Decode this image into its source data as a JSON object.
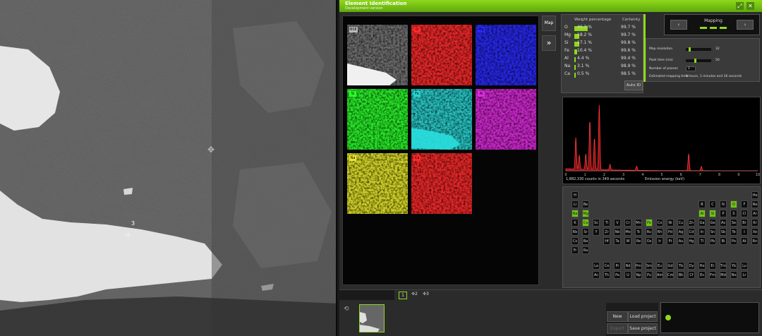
{
  "sem": {
    "point_label": "3"
  },
  "window": {
    "title": "Element Identification",
    "subtitle": "Development version",
    "pin_icon": "pin-icon",
    "close_icon": "close-icon"
  },
  "maps": [
    {
      "label": "BSE",
      "color": "#bbbbbb"
    },
    {
      "label": "O",
      "color": "#ff2a2a"
    },
    {
      "label": "Mg",
      "color": "#2a2aff"
    },
    {
      "label": "Si",
      "color": "#2aff2a"
    },
    {
      "label": "Fe",
      "color": "#2ad4d4"
    },
    {
      "label": "Al",
      "color": "#e02ae0"
    },
    {
      "label": "Na",
      "color": "#e6e62a"
    },
    {
      "label": "Ca",
      "color": "#ff2a2a"
    }
  ],
  "side": {
    "map_label": "Map",
    "forward_label": "»"
  },
  "weights": {
    "header_weight": "Weight percentage",
    "header_certainty": "Certainty",
    "rows": [
      {
        "el": "O",
        "wt": "46.3 %",
        "cert": "99.7 %",
        "frac": 0.463
      },
      {
        "el": "Mg",
        "wt": "18.2 %",
        "cert": "99.7 %",
        "frac": 0.182
      },
      {
        "el": "Si",
        "wt": "17.1 %",
        "cert": "99.8 %",
        "frac": 0.171
      },
      {
        "el": "Fe",
        "wt": "10.4 %",
        "cert": "99.6 %",
        "frac": 0.104
      },
      {
        "el": "Al",
        "wt": "4.4 %",
        "cert": "99.4 %",
        "frac": 0.044
      },
      {
        "el": "Na",
        "wt": "3.1 %",
        "cert": "98.9 %",
        "frac": 0.031
      },
      {
        "el": "Ca",
        "wt": "0.5 %",
        "cert": "98.5 %",
        "frac": 0.005
      }
    ],
    "auto_id": "Auto ID"
  },
  "mapping": {
    "title": "Mapping",
    "prev": "‹",
    "next": "›"
  },
  "params": {
    "map_resolution": "Map resolution",
    "map_resolution_val": "32",
    "pixel_time": "Pixel time (ms)",
    "pixel_time_val": "50",
    "passes": "Number of passes",
    "passes_val": "1",
    "est_time": "Estimated mapping time",
    "est_time_val": "0 hours, 1 minutes and 16 seconds"
  },
  "spectrum": {
    "counts": "1,882,330 counts in 349 seconds",
    "xlabel": "Emission energy (keV)",
    "ticks": [
      "0",
      "1",
      "2",
      "3",
      "4",
      "5",
      "6",
      "7",
      "8",
      "9",
      "10"
    ]
  },
  "periodic": {
    "highlighted": [
      "O",
      "Na",
      "Mg",
      "Al",
      "Si",
      "Ca",
      "Fe"
    ],
    "rows": [
      [
        "H",
        "",
        "",
        "",
        "",
        "",
        "",
        "",
        "",
        "",
        "",
        "",
        "",
        "",
        "",
        "",
        "",
        "He"
      ],
      [
        "Li",
        "Be",
        "",
        "",
        "",
        "",
        "",
        "",
        "",
        "",
        "",
        "",
        "B",
        "C",
        "N",
        "O",
        "F",
        "Ne"
      ],
      [
        "Na",
        "Mg",
        "",
        "",
        "",
        "",
        "",
        "",
        "",
        "",
        "",
        "",
        "Al",
        "Si",
        "P",
        "S",
        "Cl",
        "Ar"
      ],
      [
        "K",
        "Ca",
        "Sc",
        "Ti",
        "V",
        "Cr",
        "Mn",
        "Fe",
        "Co",
        "Ni",
        "Cu",
        "Zn",
        "Ga",
        "Ge",
        "As",
        "Se",
        "Br",
        "Kr"
      ],
      [
        "Rb",
        "Sr",
        "Y",
        "Zr",
        "Nb",
        "Mo",
        "Tc",
        "Ru",
        "Rh",
        "Pd",
        "Ag",
        "Cd",
        "In",
        "Sn",
        "Sb",
        "Te",
        "I",
        "Xe"
      ],
      [
        "Cs",
        "Ba",
        "",
        "Hf",
        "Ta",
        "W",
        "Re",
        "Os",
        "Ir",
        "Pt",
        "Au",
        "Hg",
        "Tl",
        "Pb",
        "Bi",
        "Po",
        "At",
        "Rn"
      ],
      [
        "Fr",
        "Ra",
        "",
        "",
        "",
        "",
        "",
        "",
        "",
        "",
        "",
        "",
        "",
        "",
        "",
        "",
        "",
        ""
      ]
    ],
    "lanthanides": [
      "La",
      "Ce",
      "Pr",
      "Nd",
      "Pm",
      "Sm",
      "Eu",
      "Gd",
      "Tb",
      "Dy",
      "Ho",
      "Er",
      "Tm",
      "Yb",
      "Lu"
    ],
    "actinides": [
      "Ac",
      "Th",
      "Pa",
      "U",
      "Np",
      "Pu",
      "Am",
      "Cm",
      "Bk",
      "Cf",
      "Es",
      "Fm",
      "Md",
      "No",
      "Lr"
    ]
  },
  "bottom": {
    "tab1": "1",
    "tab2": "2",
    "tab3": "3",
    "new": "New",
    "load": "Load project",
    "export": "Export",
    "save": "Save project"
  }
}
